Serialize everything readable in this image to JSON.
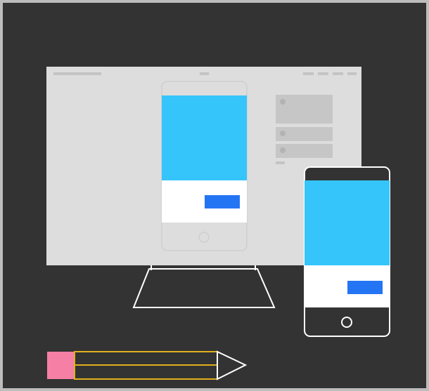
{
  "illustration": {
    "subject": "responsive-design-devices",
    "colors": {
      "frame_border": "#bdbdbd",
      "background": "#333333",
      "monitor_screen": "#dddddd",
      "monitor_stand_stroke": "#ffffff",
      "placeholder_bar": "#c4c4c4",
      "card_fill": "#c6c6c6",
      "phone_frame_on_monitor": "#d2d2d2",
      "phone_frame_standalone": "#ffffff",
      "phone_hero": "#35c5fb",
      "phone_content": "#ffffff",
      "phone_button": "#2475f4",
      "pencil_eraser": "#f57fa5",
      "pencil_body_stroke": "#e0b01c",
      "pencil_tip_stroke": "#ffffff"
    },
    "icons": {
      "monitor": "monitor-icon",
      "phone_on_monitor": "smartphone-icon",
      "phone_standalone": "smartphone-icon",
      "pencil": "pencil-icon",
      "home_button": "circle-icon"
    }
  }
}
